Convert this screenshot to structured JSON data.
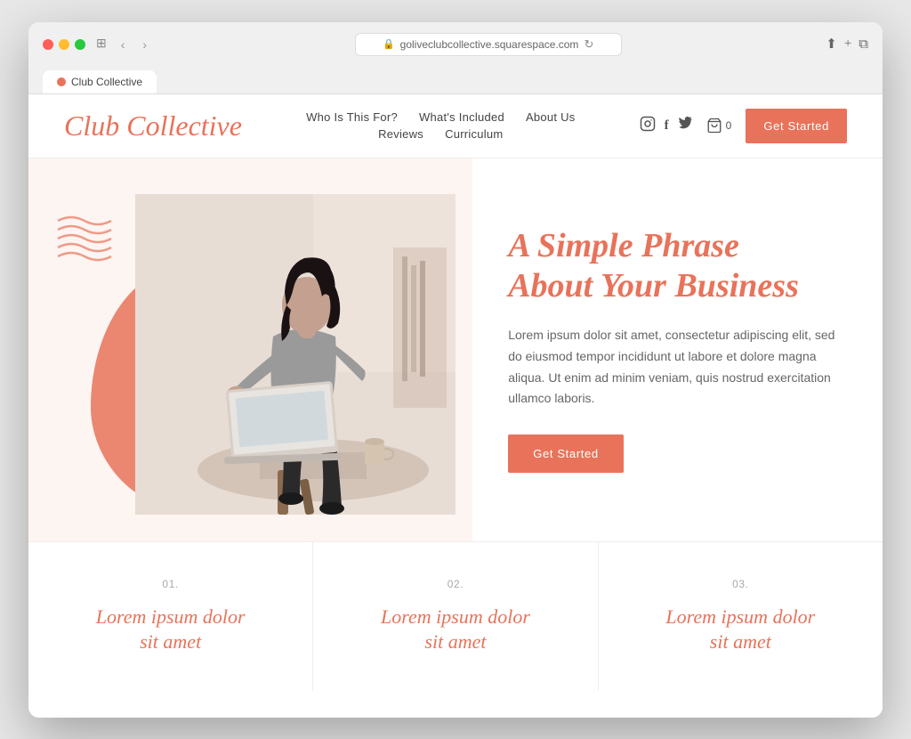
{
  "browser": {
    "url": "goliveclubcollective.squarespace.com",
    "tab_label": "Club Collective"
  },
  "header": {
    "logo": "Club Collective",
    "nav": {
      "row1": [
        {
          "label": "Who Is This For?",
          "href": "#"
        },
        {
          "label": "What's Included",
          "href": "#"
        },
        {
          "label": "About Us",
          "href": "#"
        }
      ],
      "row2": [
        {
          "label": "Reviews",
          "href": "#"
        },
        {
          "label": "Curriculum",
          "href": "#"
        }
      ]
    },
    "cart_count": "0",
    "cta_button": "Get Started"
  },
  "hero": {
    "heading_line1": "A Simple Phrase",
    "heading_line2": "About Your Business",
    "body": "Lorem ipsum dolor sit amet, consectetur adipiscing elit, sed do eiusmod tempor incididunt ut labore et dolore magna aliqua. Ut enim ad minim veniam, quis nostrud exercitation ullamco laboris.",
    "cta_button": "Get Started"
  },
  "features": [
    {
      "number": "01.",
      "title_line1": "Lorem ipsum dolor",
      "title_line2": "sit amet"
    },
    {
      "number": "02.",
      "title_line1": "Lorem ipsum dolor",
      "title_line2": "sit amet"
    },
    {
      "number": "03.",
      "title_line1": "Lorem ipsum dolor",
      "title_line2": "sit amet"
    }
  ],
  "colors": {
    "salmon": "#e8735a",
    "light_bg": "#fdf5f2",
    "text_gray": "#666"
  },
  "icons": {
    "instagram": "⬡",
    "facebook": "f",
    "twitter": "🐦",
    "cart": "🛒",
    "reload": "↻"
  }
}
